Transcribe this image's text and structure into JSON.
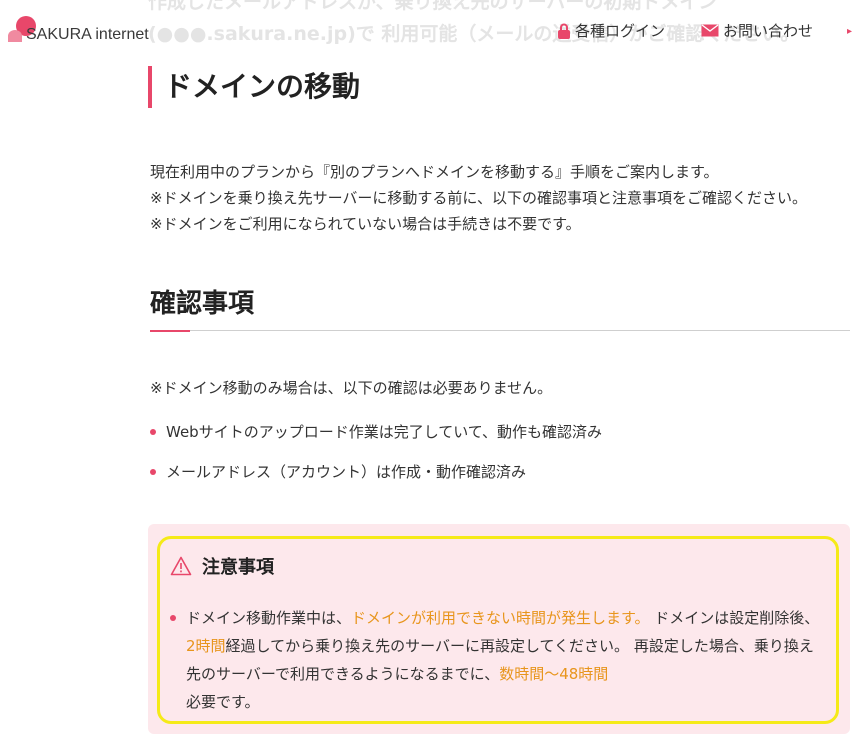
{
  "faded_background": {
    "line1": "作成したメールアドレスが、乗り換え先のサーバーの初期ドメイン",
    "line2": "(●●●.sakura.ne.jp)で 利用可能（メールの送受信）かご確認ください。"
  },
  "header": {
    "logo_text": "SAKURA internet",
    "login_label": "各種ログイン",
    "contact_label": "お問い合わせ"
  },
  "page": {
    "title": "ドメインの移動",
    "intro": [
      "現在利用中のプランから『別のプランへドメインを移動する』手順をご案内します。",
      "※ドメインを乗り換え先サーバーに移動する前に、以下の確認事項と注意事項をご確認ください。",
      "※ドメインをご利用になられていない場合は手続きは不要です。"
    ]
  },
  "confirm": {
    "heading": "確認事項",
    "note": "※ドメイン移動のみ場合は、以下の確認は必要ありません。",
    "items": [
      "Webサイトのアップロード作業は完了していて、動作も確認済み",
      "メールアドレス（アカウント）は作成・動作確認済み"
    ]
  },
  "caution": {
    "title": "注意事項",
    "text_1": "ドメイン移動作業中は、",
    "highlight_1": "ドメインが利用できない時間が発生します。",
    "text_2": " ドメインは設定削除後、",
    "highlight_2": "2時間",
    "text_3": "経過してから乗り換え先のサーバーに再設定してください。 再設定した場合、乗り換え先のサーバーで利用できるようになるまでに、",
    "highlight_3": "数時間〜48時間",
    "text_4": "必要です。"
  },
  "colors": {
    "accent": "#e8476a",
    "highlight": "#e8951c",
    "caution_bg": "#fde8ec",
    "caution_border": "#f5ea18"
  }
}
